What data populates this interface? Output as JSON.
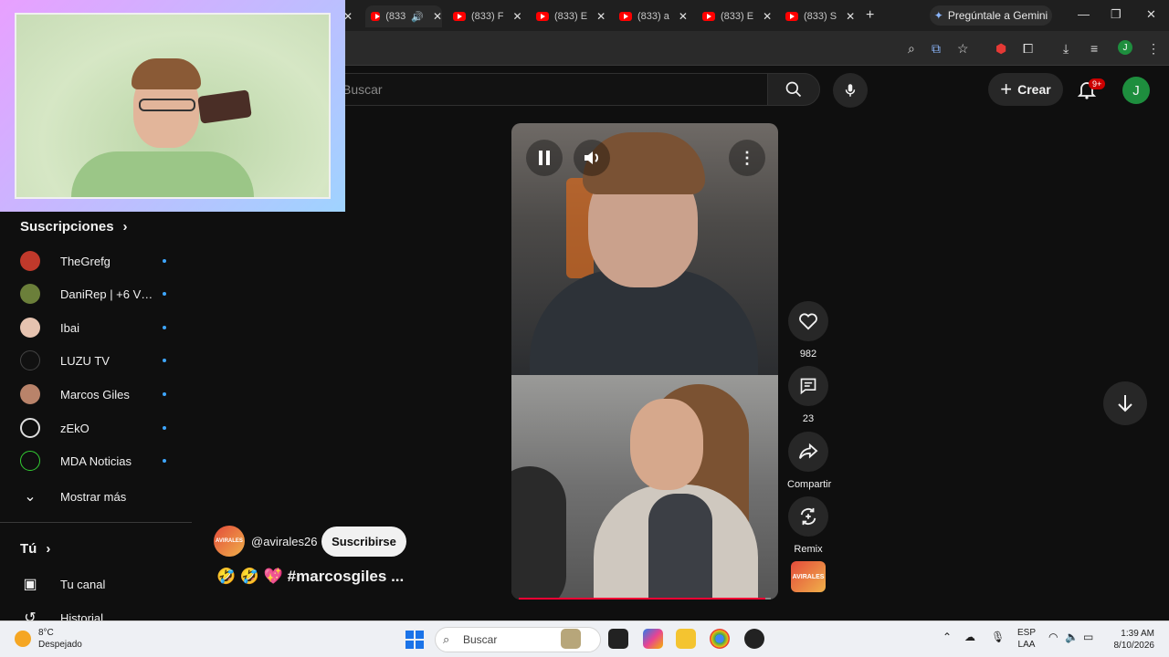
{
  "browser": {
    "tabs": [
      {
        "label": "(833"
      },
      {
        "label": "(833) F"
      },
      {
        "label": "(833) E"
      },
      {
        "label": "(833) a"
      },
      {
        "label": "(833) E"
      },
      {
        "label": "(833) S"
      }
    ],
    "gemini_label": "Pregúntale a Gemini",
    "profile_initial": "J"
  },
  "header": {
    "search_placeholder": "Buscar",
    "create_label": "Crear",
    "notifications_badge": "9+",
    "avatar_initial": "J"
  },
  "sidebar": {
    "subscriptions_title": "Suscripciones",
    "subscriptions": [
      {
        "name": "TheGrefg",
        "color": "#c0392b"
      },
      {
        "name": "DaniRep | +6 Víd...",
        "color": "#6b7f3a"
      },
      {
        "name": "Ibai",
        "color": "#e6c3b0"
      },
      {
        "name": "LUZU TV",
        "color": "#111111"
      },
      {
        "name": "Marcos Giles",
        "color": "#b9836a"
      },
      {
        "name": "zEkO",
        "color": "#0f0f0f"
      },
      {
        "name": "MDA Noticias",
        "color": "#0f0f0f"
      }
    ],
    "show_more": "Mostrar más",
    "you_title": "Tú",
    "you_items": [
      {
        "label": "Tu canal"
      },
      {
        "label": "Historial"
      }
    ]
  },
  "short": {
    "progress": 0.98,
    "likes": "982",
    "comments": "23",
    "share_label": "Compartir",
    "remix_label": "Remix",
    "channel_handle": "@avirales26",
    "channel_avatar_text": "AVIRALES",
    "subscribe_label": "Suscribirse",
    "caption": "🤣 🤣 💖 #marcosgiles ..."
  },
  "taskbar": {
    "temperature": "8°C",
    "weather_desc": "Despejado",
    "search_placeholder": "Buscar",
    "lang_top": "ESP",
    "lang_bottom": "LAA",
    "time": "1:39 AM",
    "date": "8/10/2026"
  }
}
